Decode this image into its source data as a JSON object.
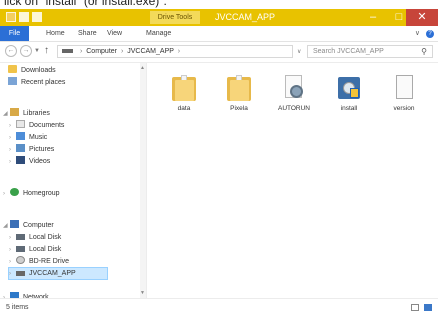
{
  "caption": "lick on \"install\" (or install.exe)\".",
  "window": {
    "title": "JVCCAM_APP",
    "context_tab": "Drive Tools",
    "controls": {
      "minimize": "–",
      "maximize": "□",
      "close": "✕"
    }
  },
  "ribbon": {
    "tabs": [
      "File",
      "Home",
      "Share",
      "View",
      "Manage"
    ],
    "expand": "∨",
    "help": "?"
  },
  "address_bar": {
    "back": "←",
    "forward": "→",
    "up": "↑",
    "path": [
      "Computer",
      "JVCCAM_APP"
    ],
    "refresh": "↻",
    "search_placeholder": "Search JVCCAM_APP"
  },
  "nav_pane": {
    "items": [
      {
        "label": "Downloads",
        "icon": "downloads-icon"
      },
      {
        "label": "Recent places",
        "icon": "recent-places-icon"
      },
      {
        "label": "Libraries",
        "icon": "libraries-icon"
      },
      {
        "label": "Documents",
        "icon": "documents-icon"
      },
      {
        "label": "Music",
        "icon": "music-icon"
      },
      {
        "label": "Pictures",
        "icon": "pictures-icon"
      },
      {
        "label": "Videos",
        "icon": "videos-icon"
      },
      {
        "label": "Homegroup",
        "icon": "homegroup-icon"
      },
      {
        "label": "Computer",
        "icon": "computer-icon"
      },
      {
        "label": "Local Disk",
        "icon": "local-disk-icon"
      },
      {
        "label": "Local Disk",
        "icon": "local-disk-icon"
      },
      {
        "label": "BD-RE Drive",
        "icon": "bd-drive-icon"
      },
      {
        "label": "JVCCAM_APP",
        "icon": "usb-drive-icon"
      },
      {
        "label": "Network",
        "icon": "network-icon"
      }
    ]
  },
  "files": [
    {
      "label": "data",
      "icon": "folder-icon"
    },
    {
      "label": "Pixela",
      "icon": "folder-icon"
    },
    {
      "label": "AUTORUN",
      "icon": "autorun-file-icon"
    },
    {
      "label": "install",
      "icon": "installer-icon"
    },
    {
      "label": "version",
      "icon": "text-file-icon"
    }
  ],
  "status": {
    "count": "5 items"
  }
}
